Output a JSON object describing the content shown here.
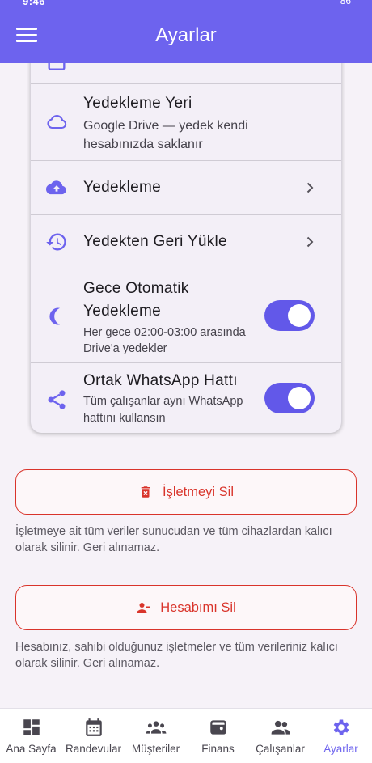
{
  "status_bar": {
    "time": "9:46",
    "battery": "86"
  },
  "app_bar": {
    "title": "Ayarlar",
    "menu_icon": "hamburger-menu-icon"
  },
  "settings_card": {
    "backup_location": {
      "title": "Yedekleme Yeri",
      "subtitle_line1": "Google Drive — yedek kendi",
      "subtitle_line2": "hesabınızda saklanır",
      "icon": "cloud-outline-icon"
    },
    "backup": {
      "title": "Yedekleme",
      "icon": "cloud-upload-icon"
    },
    "restore": {
      "title": "Yedekten Geri Yükle",
      "icon": "history-icon"
    },
    "nightly_backup": {
      "title_line1": "Gece Otomatik",
      "title_line2": "Yedekleme",
      "subtitle_line1": "Her gece 02:00-03:00 arasında",
      "subtitle_line2": "Drive'a yedekler",
      "enabled": true,
      "icon": "moon-icon"
    },
    "shared_whatsapp": {
      "title": "Ortak WhatsApp Hattı",
      "subtitle_line1": "Tüm çalışanlar aynı WhatsApp",
      "subtitle_line2": "hattını kullansın",
      "enabled": true,
      "icon": "share-icon"
    }
  },
  "delete_business": {
    "label": "İşletmeyi Sil",
    "note_line1": "İşletmeye ait tüm veriler sunucudan ve tüm cihazlardan kalıcı",
    "note_line2": "olarak silinir. Geri alınamaz.",
    "icon": "delete-forever-icon"
  },
  "delete_account": {
    "label": "Hesabımı Sil",
    "note_line1": "Hesabınız, sahibi olduğunuz işletmeler ve tüm verileriniz kalıcı",
    "note_line2": "olarak silinir. Geri alınamaz.",
    "icon": "person-remove-icon"
  },
  "colors": {
    "primary": "#6d63ee",
    "danger": "#d9342b"
  },
  "bottom_nav": {
    "items": [
      {
        "label": "Ana Sayfa",
        "icon": "dashboard-icon"
      },
      {
        "label": "Randevular",
        "icon": "calendar-icon"
      },
      {
        "label": "Müşteriler",
        "icon": "groups-icon"
      },
      {
        "label": "Finans",
        "icon": "wallet-icon"
      },
      {
        "label": "Çalışanlar",
        "icon": "people-icon"
      },
      {
        "label": "Ayarlar",
        "icon": "settings-gear-icon"
      }
    ],
    "active": "Ayarlar"
  }
}
